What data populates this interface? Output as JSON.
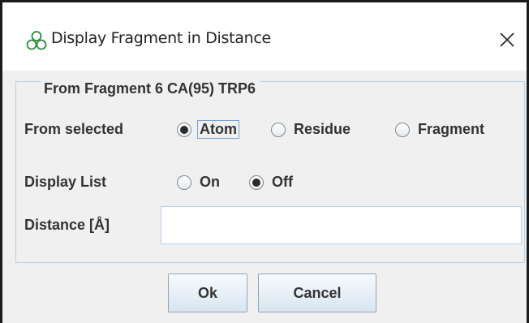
{
  "window": {
    "title": "Display Fragment in Distance",
    "app_icon": "molecule-icon",
    "close_icon": "close-icon"
  },
  "group": {
    "legend": "From Fragment 6 CA(95) TRP6"
  },
  "from_selected": {
    "label": "From selected",
    "options": [
      "Atom",
      "Residue",
      "Fragment"
    ],
    "selected": "Atom"
  },
  "display_list": {
    "label": "Display List",
    "options": [
      "On",
      "Off"
    ],
    "selected": "Off"
  },
  "distance": {
    "label": "Distance [Å]",
    "value": ""
  },
  "buttons": {
    "ok": "Ok",
    "cancel": "Cancel"
  }
}
